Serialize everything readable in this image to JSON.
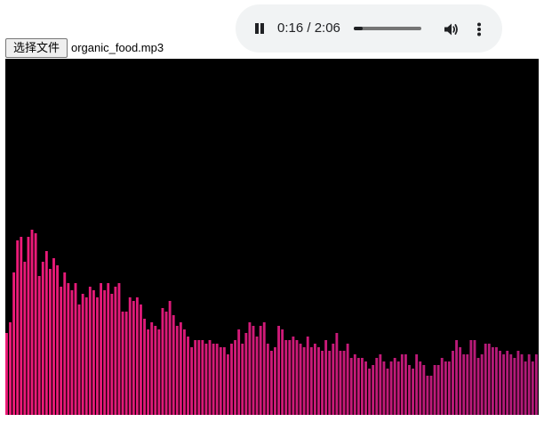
{
  "player": {
    "time_display": "0:16 / 2:06",
    "progress": 0.127,
    "icons": {
      "play_pause": "pause-icon",
      "volume": "volume-icon",
      "more": "more-vertical-icon"
    }
  },
  "file_input": {
    "button_label": "选择文件",
    "file_name": "organic_food.mp3"
  },
  "visualizer": {
    "background": "#000000",
    "color_start": "#ee1a78",
    "color_end": "#b01a78",
    "bar_levels": [
      0.23,
      0.26,
      0.4,
      0.49,
      0.5,
      0.43,
      0.5,
      0.52,
      0.51,
      0.39,
      0.43,
      0.46,
      0.41,
      0.44,
      0.42,
      0.36,
      0.4,
      0.37,
      0.35,
      0.37,
      0.31,
      0.34,
      0.33,
      0.36,
      0.35,
      0.33,
      0.37,
      0.35,
      0.37,
      0.34,
      0.36,
      0.37,
      0.29,
      0.29,
      0.33,
      0.32,
      0.33,
      0.31,
      0.27,
      0.24,
      0.26,
      0.25,
      0.24,
      0.3,
      0.29,
      0.32,
      0.28,
      0.25,
      0.26,
      0.24,
      0.22,
      0.19,
      0.21,
      0.21,
      0.21,
      0.2,
      0.21,
      0.2,
      0.2,
      0.19,
      0.19,
      0.17,
      0.2,
      0.21,
      0.24,
      0.2,
      0.23,
      0.26,
      0.25,
      0.22,
      0.25,
      0.26,
      0.2,
      0.18,
      0.19,
      0.25,
      0.24,
      0.21,
      0.21,
      0.22,
      0.21,
      0.2,
      0.19,
      0.22,
      0.19,
      0.2,
      0.19,
      0.18,
      0.21,
      0.18,
      0.2,
      0.23,
      0.18,
      0.18,
      0.2,
      0.16,
      0.17,
      0.16,
      0.16,
      0.15,
      0.13,
      0.14,
      0.16,
      0.17,
      0.15,
      0.13,
      0.15,
      0.16,
      0.15,
      0.17,
      0.17,
      0.14,
      0.13,
      0.17,
      0.15,
      0.14,
      0.11,
      0.11,
      0.14,
      0.14,
      0.16,
      0.15,
      0.15,
      0.18,
      0.21,
      0.19,
      0.17,
      0.17,
      0.21,
      0.21,
      0.16,
      0.17,
      0.2,
      0.2,
      0.19,
      0.19,
      0.18,
      0.17,
      0.18,
      0.17,
      0.16,
      0.18,
      0.17,
      0.15,
      0.17,
      0.15,
      0.17
    ]
  }
}
